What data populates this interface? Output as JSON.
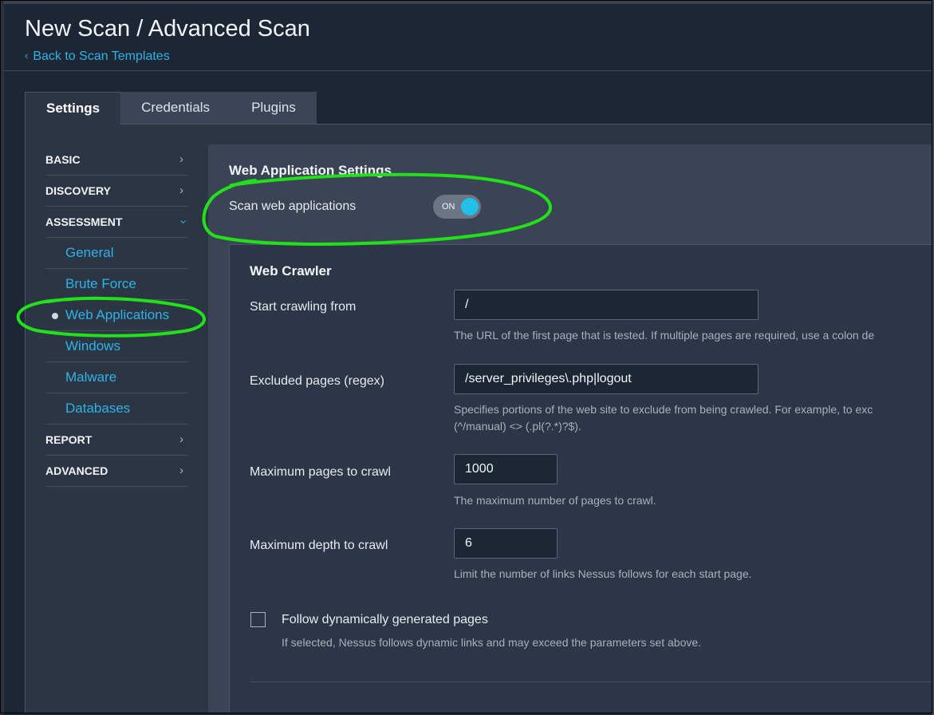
{
  "header": {
    "title": "New Scan / Advanced Scan",
    "back_link": "Back to Scan Templates"
  },
  "tabs": [
    {
      "label": "Settings",
      "active": true
    },
    {
      "label": "Credentials",
      "active": false
    },
    {
      "label": "Plugins",
      "active": false
    }
  ],
  "sidebar": {
    "items": [
      {
        "label": "BASIC",
        "type": "section"
      },
      {
        "label": "DISCOVERY",
        "type": "section"
      },
      {
        "label": "ASSESSMENT",
        "type": "section",
        "expanded": true
      },
      {
        "label": "General",
        "type": "sub"
      },
      {
        "label": "Brute Force",
        "type": "sub"
      },
      {
        "label": "Web Applications",
        "type": "sub",
        "selected": true
      },
      {
        "label": "Windows",
        "type": "sub"
      },
      {
        "label": "Malware",
        "type": "sub"
      },
      {
        "label": "Databases",
        "type": "sub"
      },
      {
        "label": "REPORT",
        "type": "section"
      },
      {
        "label": "ADVANCED",
        "type": "section"
      }
    ]
  },
  "web_app_settings": {
    "title": "Web Application Settings",
    "scan_label": "Scan web applications",
    "toggle_text": "ON",
    "toggle_state": "on"
  },
  "web_crawler": {
    "title": "Web Crawler",
    "start_label": "Start crawling from",
    "start_value": "/",
    "start_help": "The URL of the first page that is tested. If multiple pages are required, use a colon de",
    "excluded_label": "Excluded pages (regex)",
    "excluded_value": "/server_privileges\\.php|logout",
    "excluded_help_1": "Specifies portions of the web site to exclude from being crawled. For example, to exc",
    "excluded_help_2": "(^/manual) <> (.pl(?.*)?$).",
    "max_pages_label": "Maximum pages to crawl",
    "max_pages_value": "1000",
    "max_pages_help": "The maximum number of pages to crawl.",
    "max_depth_label": "Maximum depth to crawl",
    "max_depth_value": "6",
    "max_depth_help": "Limit the number of links Nessus follows for each start page.",
    "follow_label": "Follow dynamically generated pages",
    "follow_help": "If selected, Nessus follows dynamic links and may exceed the parameters set above.",
    "follow_checked": false
  },
  "colors": {
    "accent": "#2fb3e6",
    "toggle_knob": "#20c0e8",
    "annotation": "#22e01a"
  }
}
